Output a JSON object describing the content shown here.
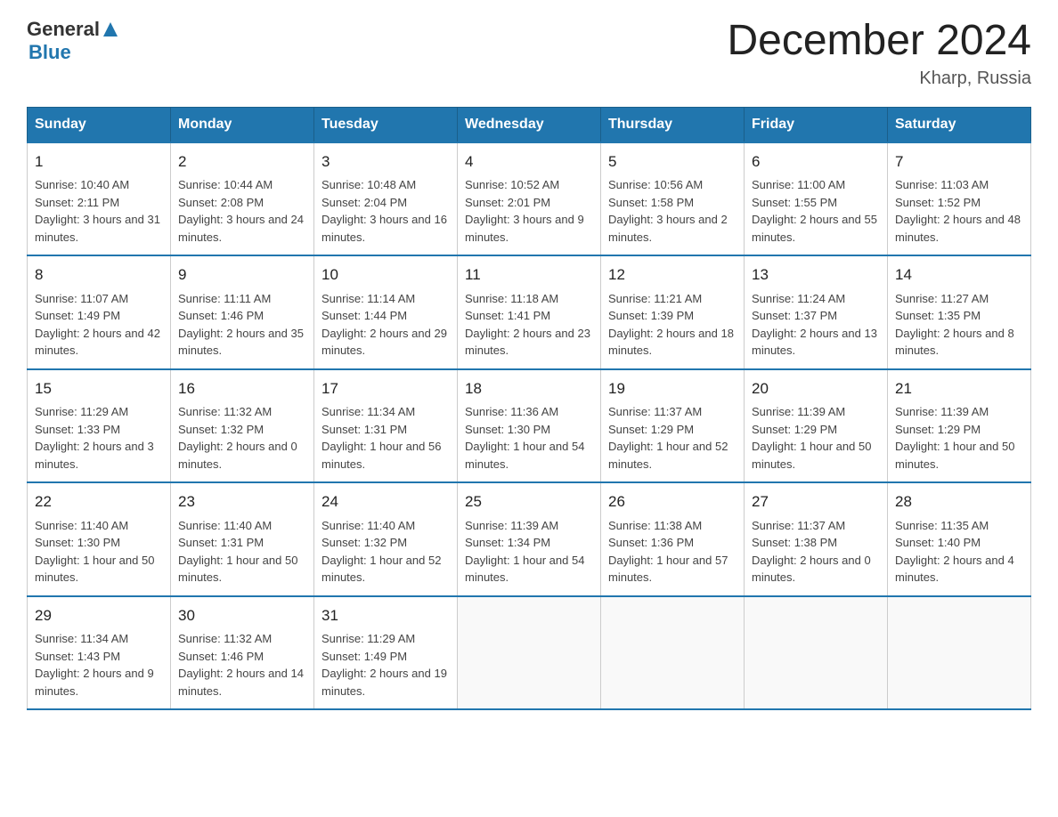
{
  "header": {
    "logo_general": "General",
    "logo_blue": "Blue",
    "month_title": "December 2024",
    "location": "Kharp, Russia"
  },
  "days_of_week": [
    "Sunday",
    "Monday",
    "Tuesday",
    "Wednesday",
    "Thursday",
    "Friday",
    "Saturday"
  ],
  "weeks": [
    [
      {
        "day": "1",
        "sunrise": "10:40 AM",
        "sunset": "2:11 PM",
        "daylight": "3 hours and 31 minutes."
      },
      {
        "day": "2",
        "sunrise": "10:44 AM",
        "sunset": "2:08 PM",
        "daylight": "3 hours and 24 minutes."
      },
      {
        "day": "3",
        "sunrise": "10:48 AM",
        "sunset": "2:04 PM",
        "daylight": "3 hours and 16 minutes."
      },
      {
        "day": "4",
        "sunrise": "10:52 AM",
        "sunset": "2:01 PM",
        "daylight": "3 hours and 9 minutes."
      },
      {
        "day": "5",
        "sunrise": "10:56 AM",
        "sunset": "1:58 PM",
        "daylight": "3 hours and 2 minutes."
      },
      {
        "day": "6",
        "sunrise": "11:00 AM",
        "sunset": "1:55 PM",
        "daylight": "2 hours and 55 minutes."
      },
      {
        "day": "7",
        "sunrise": "11:03 AM",
        "sunset": "1:52 PM",
        "daylight": "2 hours and 48 minutes."
      }
    ],
    [
      {
        "day": "8",
        "sunrise": "11:07 AM",
        "sunset": "1:49 PM",
        "daylight": "2 hours and 42 minutes."
      },
      {
        "day": "9",
        "sunrise": "11:11 AM",
        "sunset": "1:46 PM",
        "daylight": "2 hours and 35 minutes."
      },
      {
        "day": "10",
        "sunrise": "11:14 AM",
        "sunset": "1:44 PM",
        "daylight": "2 hours and 29 minutes."
      },
      {
        "day": "11",
        "sunrise": "11:18 AM",
        "sunset": "1:41 PM",
        "daylight": "2 hours and 23 minutes."
      },
      {
        "day": "12",
        "sunrise": "11:21 AM",
        "sunset": "1:39 PM",
        "daylight": "2 hours and 18 minutes."
      },
      {
        "day": "13",
        "sunrise": "11:24 AM",
        "sunset": "1:37 PM",
        "daylight": "2 hours and 13 minutes."
      },
      {
        "day": "14",
        "sunrise": "11:27 AM",
        "sunset": "1:35 PM",
        "daylight": "2 hours and 8 minutes."
      }
    ],
    [
      {
        "day": "15",
        "sunrise": "11:29 AM",
        "sunset": "1:33 PM",
        "daylight": "2 hours and 3 minutes."
      },
      {
        "day": "16",
        "sunrise": "11:32 AM",
        "sunset": "1:32 PM",
        "daylight": "2 hours and 0 minutes."
      },
      {
        "day": "17",
        "sunrise": "11:34 AM",
        "sunset": "1:31 PM",
        "daylight": "1 hour and 56 minutes."
      },
      {
        "day": "18",
        "sunrise": "11:36 AM",
        "sunset": "1:30 PM",
        "daylight": "1 hour and 54 minutes."
      },
      {
        "day": "19",
        "sunrise": "11:37 AM",
        "sunset": "1:29 PM",
        "daylight": "1 hour and 52 minutes."
      },
      {
        "day": "20",
        "sunrise": "11:39 AM",
        "sunset": "1:29 PM",
        "daylight": "1 hour and 50 minutes."
      },
      {
        "day": "21",
        "sunrise": "11:39 AM",
        "sunset": "1:29 PM",
        "daylight": "1 hour and 50 minutes."
      }
    ],
    [
      {
        "day": "22",
        "sunrise": "11:40 AM",
        "sunset": "1:30 PM",
        "daylight": "1 hour and 50 minutes."
      },
      {
        "day": "23",
        "sunrise": "11:40 AM",
        "sunset": "1:31 PM",
        "daylight": "1 hour and 50 minutes."
      },
      {
        "day": "24",
        "sunrise": "11:40 AM",
        "sunset": "1:32 PM",
        "daylight": "1 hour and 52 minutes."
      },
      {
        "day": "25",
        "sunrise": "11:39 AM",
        "sunset": "1:34 PM",
        "daylight": "1 hour and 54 minutes."
      },
      {
        "day": "26",
        "sunrise": "11:38 AM",
        "sunset": "1:36 PM",
        "daylight": "1 hour and 57 minutes."
      },
      {
        "day": "27",
        "sunrise": "11:37 AM",
        "sunset": "1:38 PM",
        "daylight": "2 hours and 0 minutes."
      },
      {
        "day": "28",
        "sunrise": "11:35 AM",
        "sunset": "1:40 PM",
        "daylight": "2 hours and 4 minutes."
      }
    ],
    [
      {
        "day": "29",
        "sunrise": "11:34 AM",
        "sunset": "1:43 PM",
        "daylight": "2 hours and 9 minutes."
      },
      {
        "day": "30",
        "sunrise": "11:32 AM",
        "sunset": "1:46 PM",
        "daylight": "2 hours and 14 minutes."
      },
      {
        "day": "31",
        "sunrise": "11:29 AM",
        "sunset": "1:49 PM",
        "daylight": "2 hours and 19 minutes."
      },
      null,
      null,
      null,
      null
    ]
  ]
}
